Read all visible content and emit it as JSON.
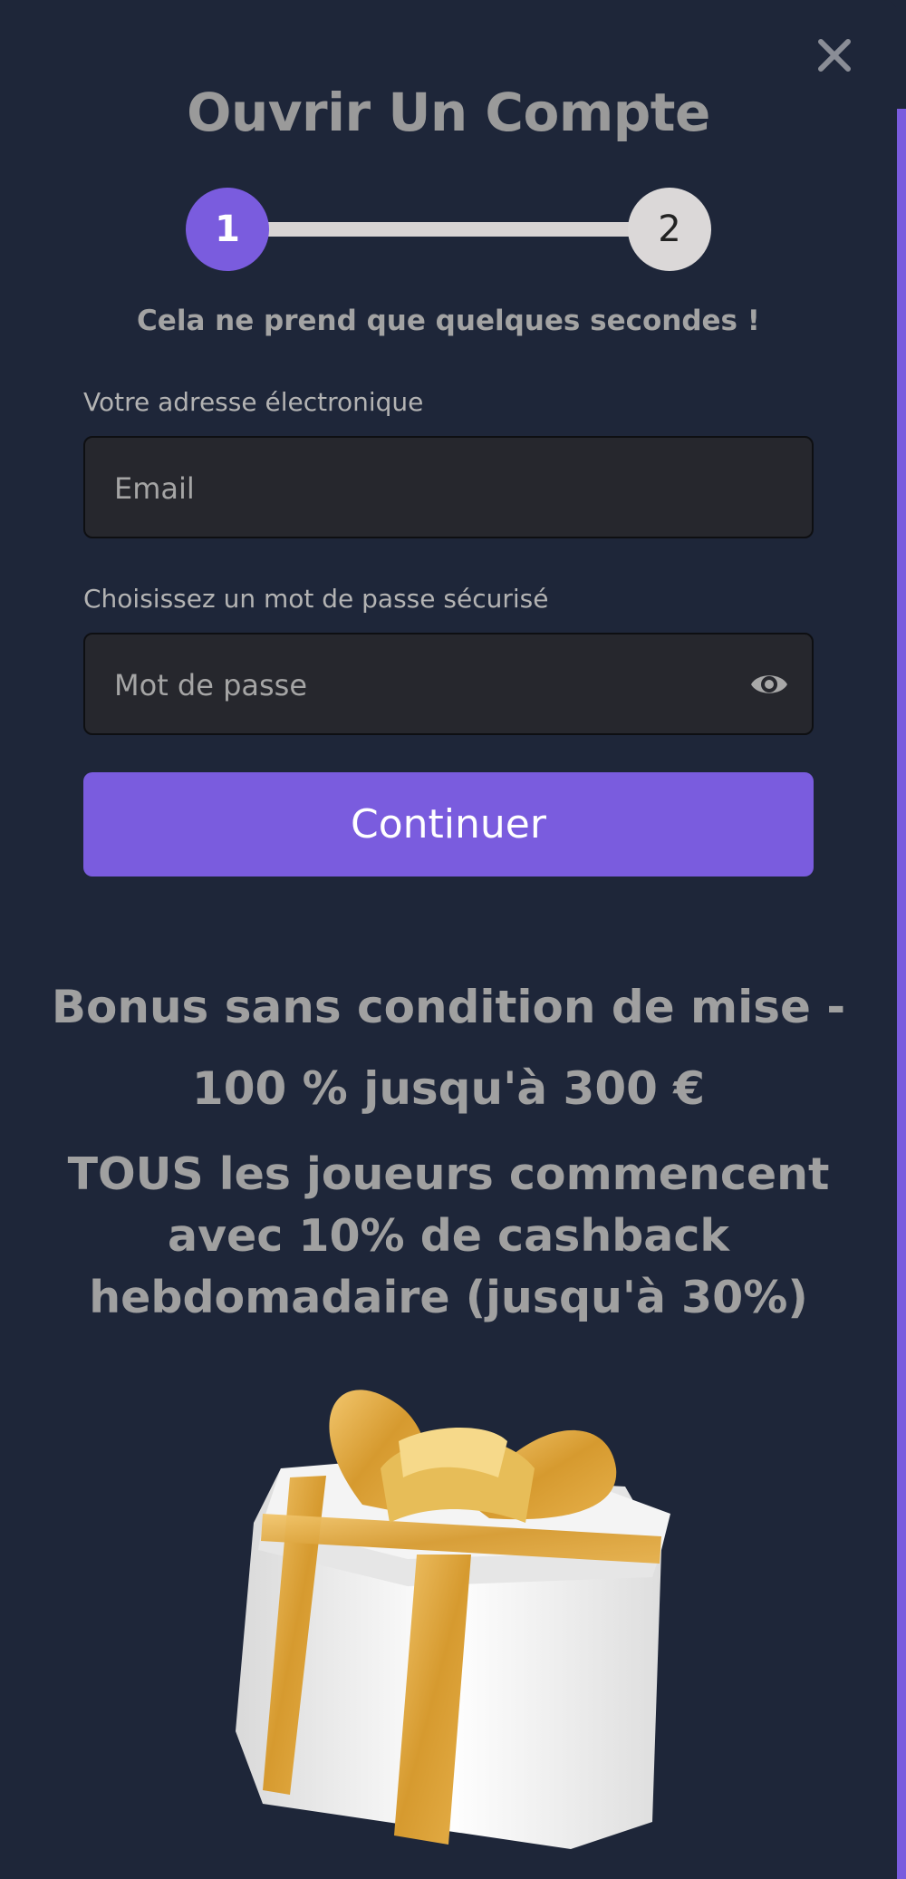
{
  "modal": {
    "title": "Ouvrir Un Compte",
    "subtitle": "Cela ne prend que quelques secondes !",
    "close_icon": "close-icon",
    "accent_color": "#7a5cde",
    "background_color": "#1e2639"
  },
  "stepper": {
    "current_step": 1,
    "steps": [
      {
        "label": "1",
        "state": "active"
      },
      {
        "label": "2",
        "state": "inactive"
      }
    ]
  },
  "form": {
    "email": {
      "label": "Votre adresse électronique",
      "placeholder": "Email",
      "value": ""
    },
    "password": {
      "label": "Choisissez un mot de passe sécurisé",
      "placeholder": "Mot de passe",
      "value": "",
      "toggle_icon": "eye-icon"
    },
    "submit_label": "Continuer"
  },
  "bonus": {
    "line1": "Bonus sans condition de mise -",
    "line2": "100 % jusqu'à 300 €",
    "line3": "TOUS les joueurs commencent avec 10% de cashback hebdomadaire (jusqu'à 30%)",
    "image_icon": "gift-box-icon"
  }
}
